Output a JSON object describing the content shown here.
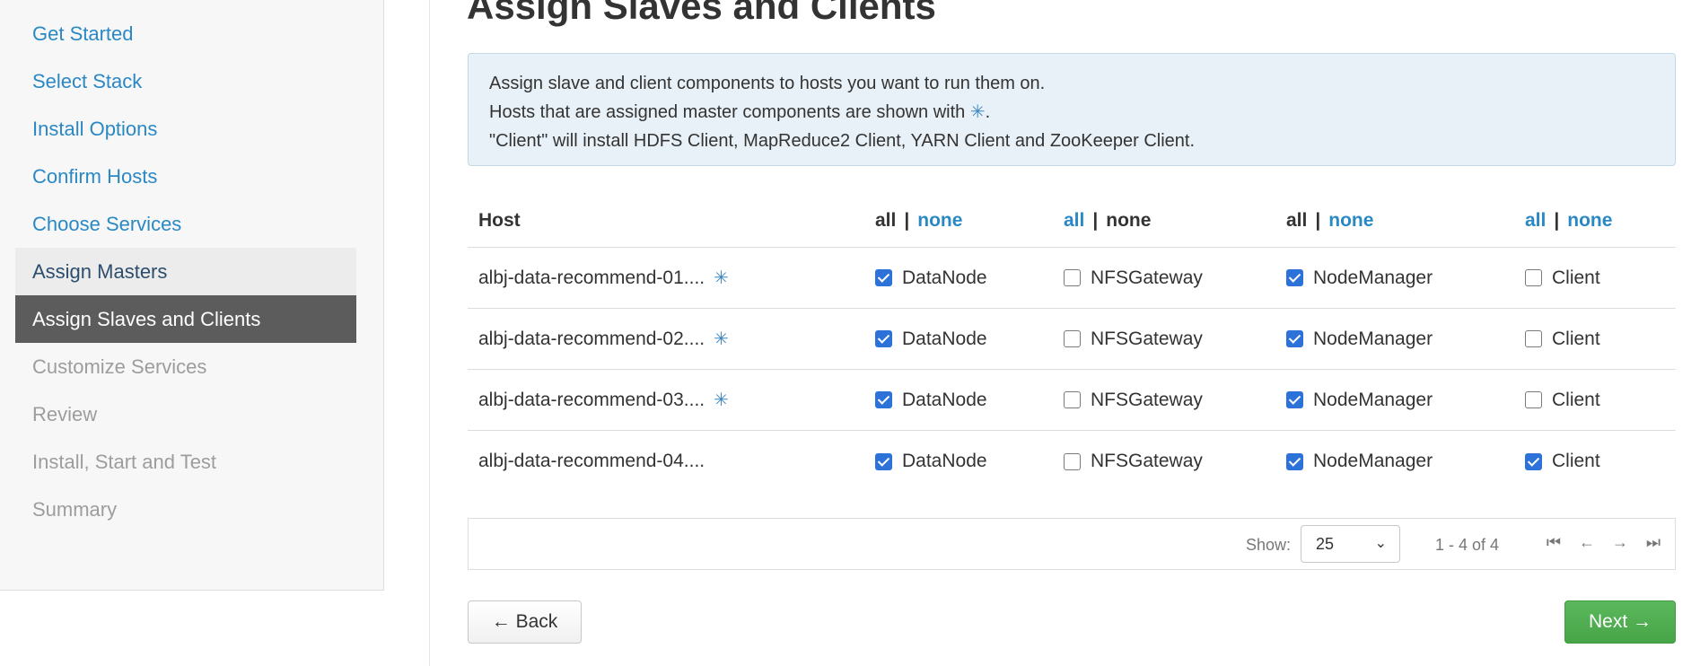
{
  "sidebar": {
    "items": [
      {
        "label": "Get Started",
        "state": "link"
      },
      {
        "label": "Select Stack",
        "state": "link"
      },
      {
        "label": "Install Options",
        "state": "link"
      },
      {
        "label": "Confirm Hosts",
        "state": "link"
      },
      {
        "label": "Choose Services",
        "state": "link"
      },
      {
        "label": "Assign Masters",
        "state": "done"
      },
      {
        "label": "Assign Slaves and Clients",
        "state": "active"
      },
      {
        "label": "Customize Services",
        "state": "disabled"
      },
      {
        "label": "Review",
        "state": "disabled"
      },
      {
        "label": "Install, Start and Test",
        "state": "disabled"
      },
      {
        "label": "Summary",
        "state": "disabled"
      }
    ]
  },
  "page": {
    "title": "Assign Slaves and Clients"
  },
  "info": {
    "line1": "Assign slave and client components to hosts you want to run them on.",
    "line2_prefix": "Hosts that are assigned master components are shown with ",
    "line2_star": "✳",
    "line2_suffix": ".",
    "line3": "\"Client\" will install HDFS Client, MapReduce2 Client, YARN Client and ZooKeeper Client."
  },
  "table": {
    "host_header": "Host",
    "all_label": "all",
    "none_label": "none",
    "pipe": "|",
    "columns": [
      {
        "component": "DataNode",
        "active_link": "none"
      },
      {
        "component": "NFSGateway",
        "active_link": "all"
      },
      {
        "component": "NodeManager",
        "active_link": "none"
      },
      {
        "component": "Client",
        "active_link": "both"
      }
    ],
    "rows": [
      {
        "host": "albj-data-recommend-01....",
        "master": true,
        "star": "✳",
        "checks": [
          true,
          false,
          true,
          false
        ]
      },
      {
        "host": "albj-data-recommend-02....",
        "master": true,
        "star": "✳",
        "checks": [
          true,
          false,
          true,
          false
        ]
      },
      {
        "host": "albj-data-recommend-03....",
        "master": true,
        "star": "✳",
        "checks": [
          true,
          false,
          true,
          false
        ]
      },
      {
        "host": "albj-data-recommend-04....",
        "master": false,
        "star": "",
        "checks": [
          true,
          false,
          true,
          true
        ]
      }
    ]
  },
  "pager": {
    "show_label": "Show:",
    "page_size": "25",
    "range": "1 - 4 of 4",
    "first_icon": "⏮",
    "prev_icon": "←",
    "next_icon": "→",
    "last_icon": "⏭"
  },
  "buttons": {
    "back": "← Back",
    "next": "Next →"
  }
}
